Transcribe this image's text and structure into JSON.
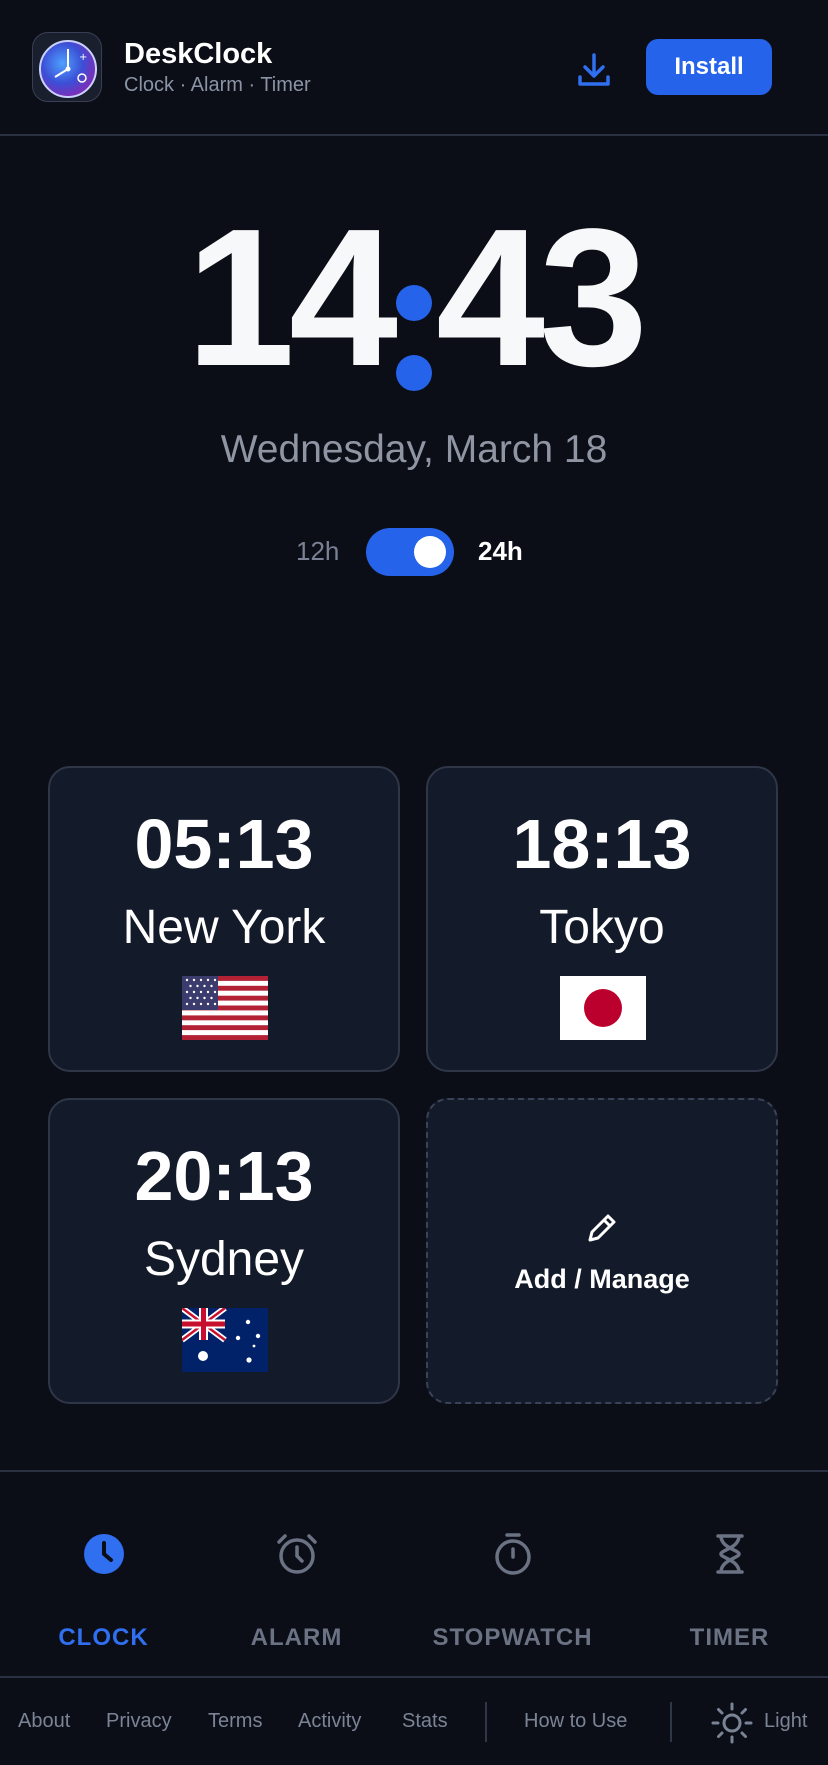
{
  "header": {
    "app_name": "DeskClock",
    "app_subtitle": "Clock · Alarm · Timer",
    "install_label": "Install"
  },
  "clock": {
    "hours": "14",
    "minutes": "43",
    "date": "Wednesday, March 18",
    "format_12": "12h",
    "format_24": "24h",
    "format_24_enabled": true
  },
  "world_clocks": [
    {
      "time": "05:13",
      "city": "New York",
      "flag": "us-flag"
    },
    {
      "time": "18:13",
      "city": "Tokyo",
      "flag": "jp-flag"
    },
    {
      "time": "20:13",
      "city": "Sydney",
      "flag": "au-flag"
    }
  ],
  "add_card": {
    "label": "Add / Manage"
  },
  "nav": [
    {
      "label": "CLOCK",
      "icon": "clock-icon",
      "active": true
    },
    {
      "label": "ALARM",
      "icon": "alarm-icon",
      "active": false
    },
    {
      "label": "STOPWATCH",
      "icon": "stopwatch-icon",
      "active": false
    },
    {
      "label": "TIMER",
      "icon": "hourglass-icon",
      "active": false
    }
  ],
  "footer": {
    "links": [
      "About",
      "Privacy",
      "Terms",
      "Activity",
      "Stats"
    ],
    "how_to_use": "How to Use",
    "theme_label": "Light"
  },
  "colors": {
    "background": "#0b0e16",
    "accent": "#2563eb",
    "card": "#131a29"
  }
}
